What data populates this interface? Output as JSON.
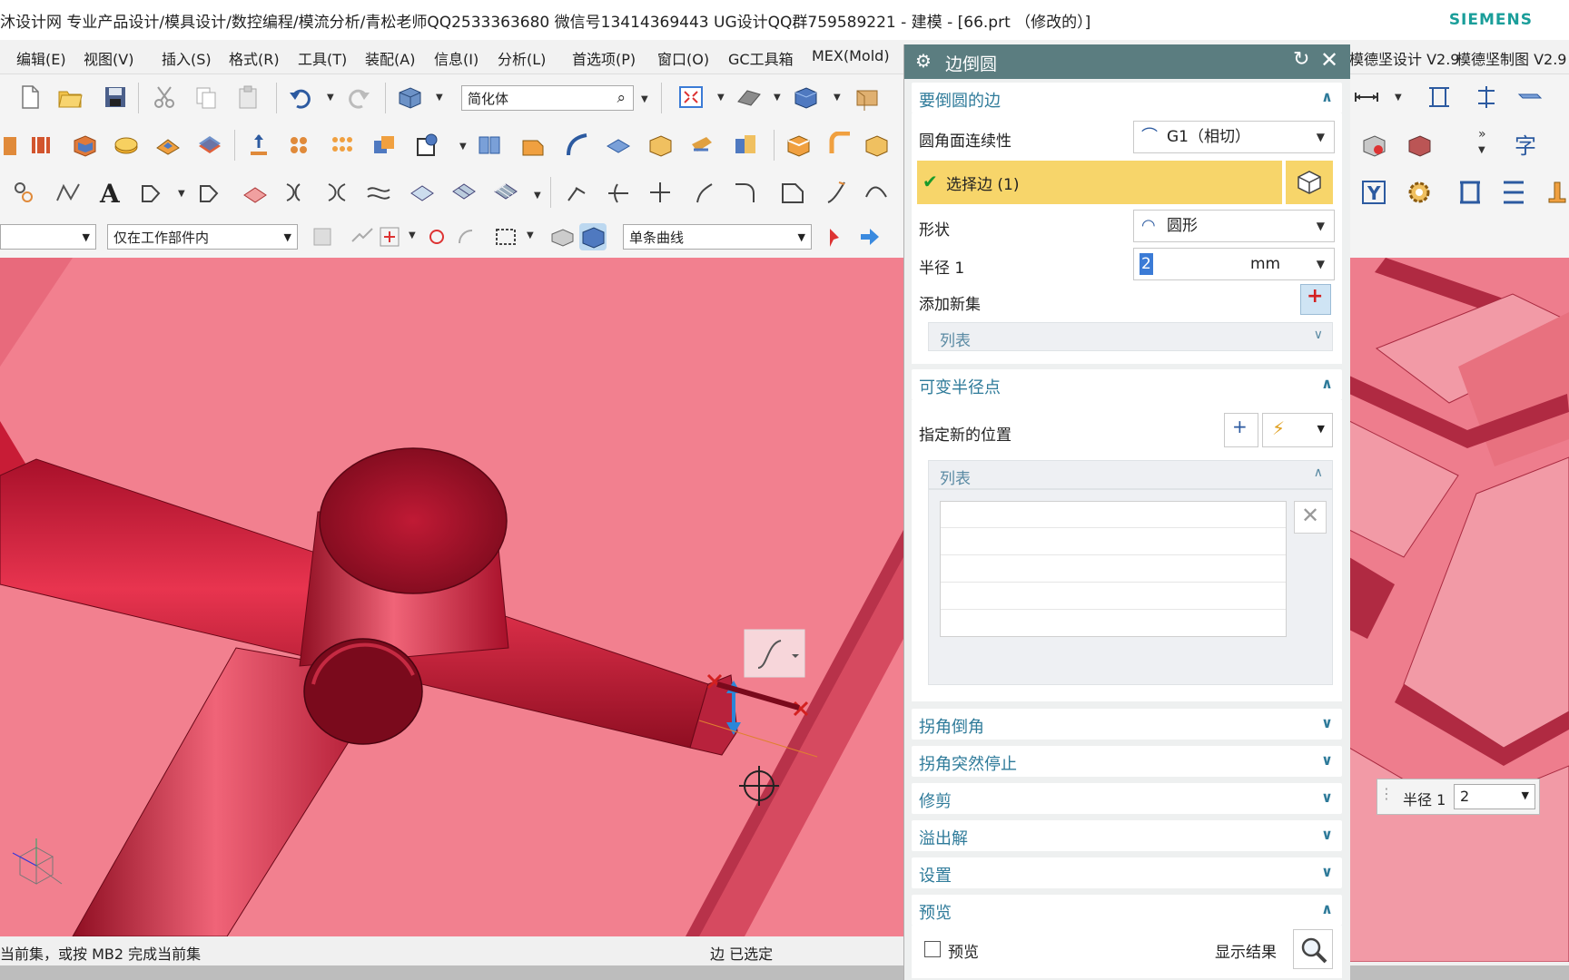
{
  "window": {
    "title": "沐设计网 专业产品设计/模具设计/数控编程/模流分析/青松老师QQ2533363680 微信号13414369443 UG设计QQ群759589221 - 建模 - [66.prt （修改的）]",
    "brand": "SIEMENS"
  },
  "menu": [
    "编辑(E)",
    "视图(V)",
    "插入(S)",
    "格式(R)",
    "工具(T)",
    "装配(A)",
    "信息(I)",
    "分析(L)",
    "首选项(P)",
    "窗口(O)",
    "GC工具箱",
    "MEX(Mold)"
  ],
  "menu_right": [
    "模德坚设计 V2.9",
    "模德坚制图 V2.9"
  ],
  "toolbar": {
    "search_placeholder": "简化体",
    "filter_scope": "仅在工作部件内",
    "curve_rule": "单条曲线"
  },
  "statusbar": {
    "left": "当前集，或按 MB2 完成当前集",
    "center": "边 已选定"
  },
  "dialog": {
    "title": "边倒圆",
    "group_edges": {
      "title": "要倒圆的边",
      "continuity_label": "圆角面连续性",
      "continuity_value": "G1（相切）",
      "select_edge": "选择边 (1)",
      "shape_label": "形状",
      "shape_value": "圆形",
      "radius_label": "半径 1",
      "radius_value": "2",
      "radius_unit": "mm",
      "add_set_label": "添加新集",
      "list_label": "列表"
    },
    "group_variable": {
      "title": "可变半径点",
      "specify_label": "指定新的位置",
      "list_label": "列表"
    },
    "collapsed_groups": [
      "拐角倒角",
      "拐角突然停止",
      "修剪",
      "溢出解",
      "设置"
    ],
    "group_preview": {
      "title": "预览",
      "preview_checkbox": "预览",
      "show_result": "显示结果"
    }
  },
  "float_radius": {
    "label": "半径 1",
    "value": "2"
  },
  "colors": {
    "dialog_header": "#5b7d80",
    "group_title": "#2f7b9a",
    "highlight": "#f7d56a",
    "model": "#d8243a",
    "viewport_bg": "#f28090"
  }
}
